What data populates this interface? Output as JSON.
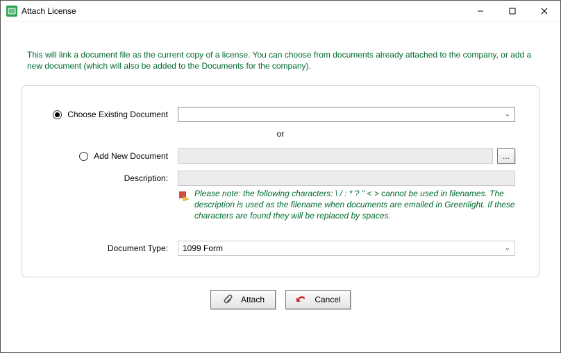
{
  "window": {
    "title": "Attach License"
  },
  "intro": "This will link a document file as the current copy of a license.  You can choose from documents already attached to the company, or add a new document (which will also be added to the Documents for the  company).",
  "form": {
    "choose_existing_label": "Choose Existing Document",
    "or_label": "or",
    "add_new_label": "Add New Document",
    "browse_label": "...",
    "description_label": "Description:",
    "note_text": "Please note:  the following characters:  \\ / : * ? \" < > cannot be used in filenames.  The description is used as the filename when documents are emailed in Greenlight.  If these characters are found they will be replaced by spaces.",
    "document_type_label": "Document Type:",
    "document_type_value": "1099 Form"
  },
  "buttons": {
    "attach": "Attach",
    "cancel": "Cancel"
  }
}
